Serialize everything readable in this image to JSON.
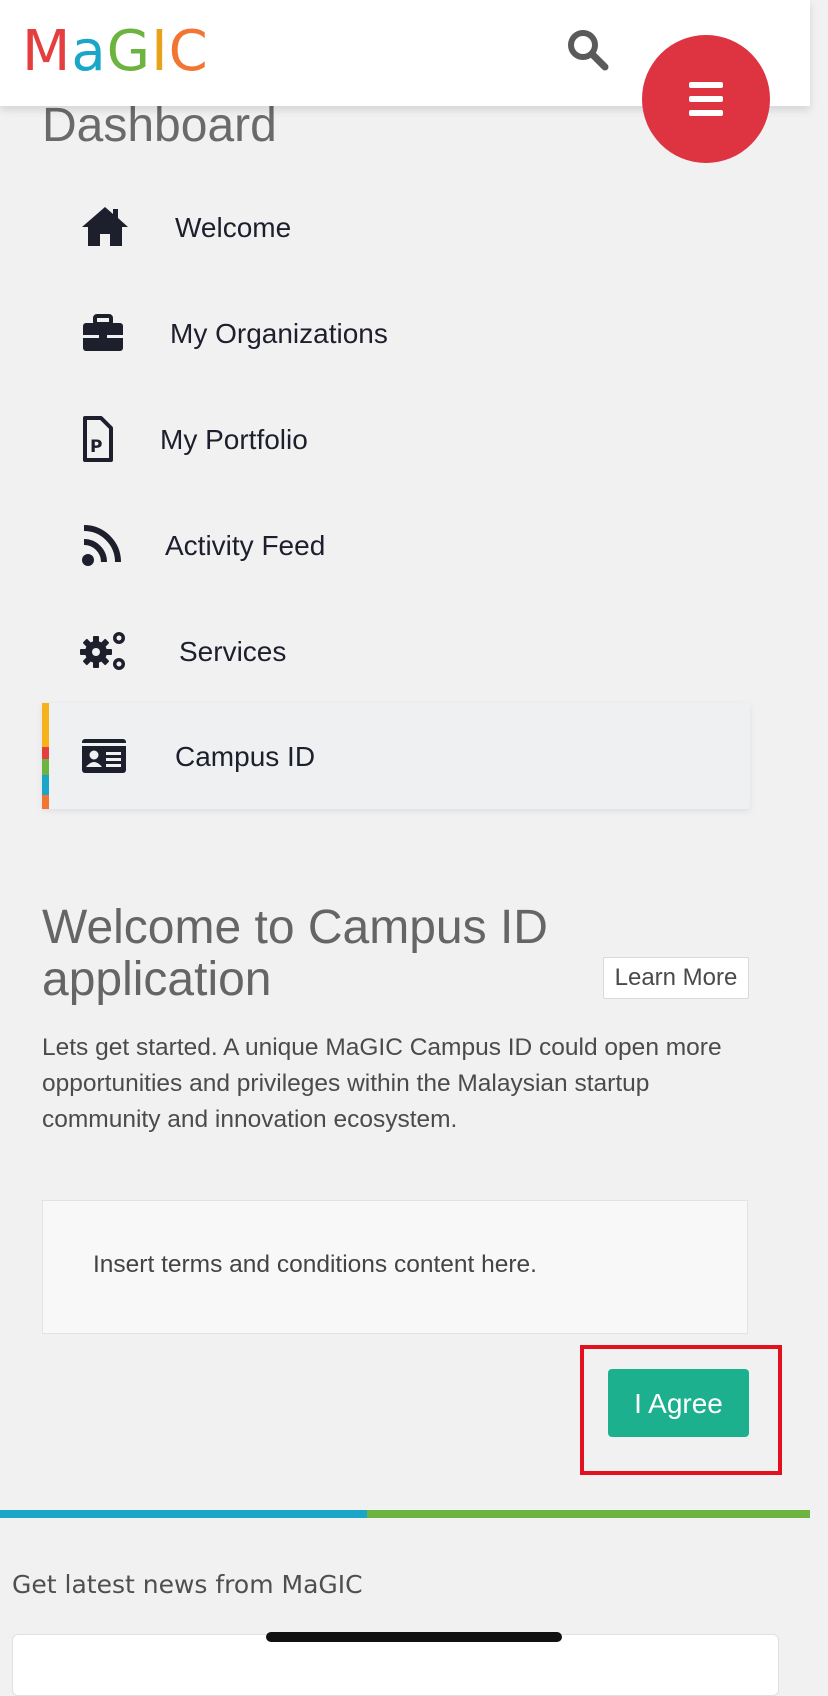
{
  "header": {
    "logo_letters": [
      {
        "char": "M",
        "color": "#e43e3f"
      },
      {
        "char": "a",
        "color": "#1aa6c9"
      },
      {
        "char": "G",
        "color": "#6db33f"
      },
      {
        "char": "I",
        "color": "#e8a21a"
      },
      {
        "char": "C",
        "color": "#f27533"
      }
    ],
    "search_icon": "search-icon",
    "menu_icon": "hamburger-icon",
    "menu_color": "#de3340"
  },
  "sidebar": {
    "title": "Dashboard",
    "items": [
      {
        "label": "Welcome",
        "icon": "home-icon"
      },
      {
        "label": "My Organizations",
        "icon": "briefcase-icon"
      },
      {
        "label": "My Portfolio",
        "icon": "document-icon"
      },
      {
        "label": "Activity Feed",
        "icon": "rss-icon"
      },
      {
        "label": "Services",
        "icon": "gears-icon"
      },
      {
        "label": "Campus ID",
        "icon": "id-card-icon",
        "active": true
      }
    ],
    "accent_colors": [
      "#f5b21b",
      "#e43e3f",
      "#6db33f",
      "#1aa6c9",
      "#f27533"
    ]
  },
  "main": {
    "heading": "Welcome to Campus ID application",
    "learn_more_label": "Learn More",
    "intro": "Lets get started. A unique MaGIC Campus ID could open more opportunities and privileges within the Malaysian startup community and innovation ecosystem.",
    "terms_text": "Insert terms and conditions content here.",
    "agree_label": "I Agree",
    "agree_color": "#1db08e"
  },
  "footer": {
    "divider_colors": [
      "#1aa6c9",
      "#6db33f"
    ],
    "news_heading": "Get latest news from MaGIC"
  }
}
